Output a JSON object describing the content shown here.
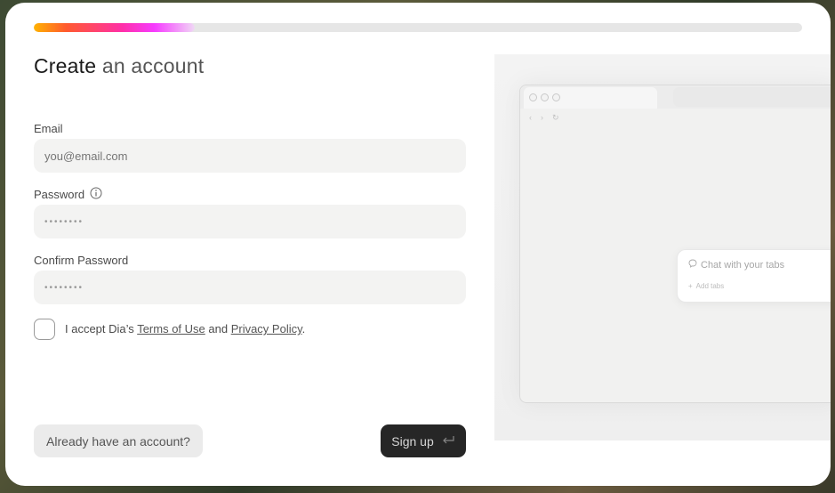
{
  "progress": {
    "value_percent": 21
  },
  "form": {
    "title_main": "Create",
    "title_rest": " an account",
    "email": {
      "label": "Email",
      "placeholder": "you@email.com"
    },
    "password": {
      "label": "Password",
      "masked": "••••••••"
    },
    "confirm_password": {
      "label": "Confirm Password",
      "masked": "••••••••"
    },
    "terms": {
      "prefix": "I accept Dia’s ",
      "terms_link": "Terms of Use",
      "middle": " and ",
      "privacy_link": "Privacy Policy",
      "suffix": "."
    },
    "already_button": "Already have an account?",
    "signup_button": "Sign up"
  },
  "preview": {
    "nav_back": "‹",
    "nav_forward": "›",
    "nav_reload": "↻",
    "chat_placeholder": "Chat with your tabs",
    "add_tabs": "Add tabs"
  },
  "colors": {
    "accent_gradient": [
      "#ffb300",
      "#ff5a2e",
      "#ff2fa8",
      "#f63bff"
    ],
    "primary_button": "#262626",
    "field_bg": "#f3f3f2"
  },
  "icons": {
    "password_info": "info-icon",
    "signup": "return-arrow-icon",
    "chat": "chat-bubble-icon",
    "add": "plus-icon"
  }
}
